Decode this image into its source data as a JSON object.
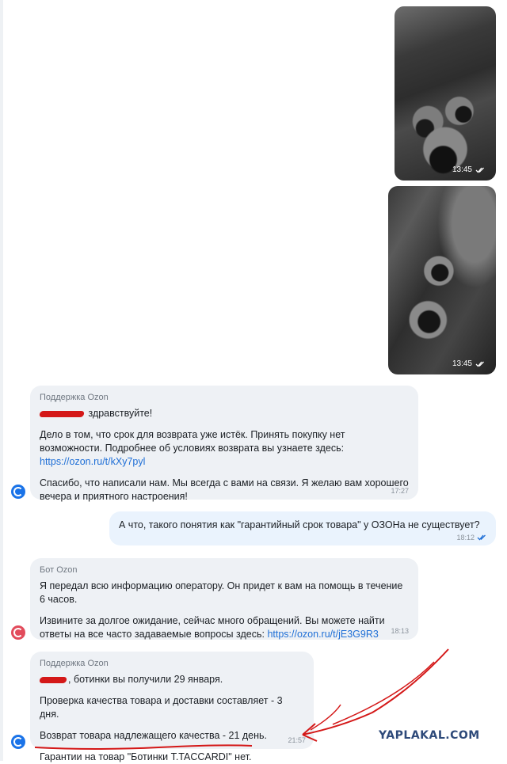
{
  "photos": [
    {
      "time": "13:45"
    },
    {
      "time": "13:45"
    }
  ],
  "messages": {
    "support1": {
      "sender": "Поддержка Ozon",
      "greeting": "здравствуйте!",
      "p1_text": "Дело в том, что срок для возврата уже истёк. Принять покупку нет возможности. Подробнее об условиях возврата вы узнаете здесь:",
      "p1_link": "https://ozon.ru/t/kXy7pyl",
      "p2": "Спасибо, что написали нам. Мы всегда с вами на связи. Я желаю вам хорошего вечера и приятного настроения!",
      "time": "17:27"
    },
    "user": {
      "text": "А что, такого понятия как \"гарантийный срок товара\" у ОЗОНа не существует?",
      "time": "18:12"
    },
    "bot": {
      "sender": "Бот Ozon",
      "p1": "Я передал всю информацию оператору. Он придет к вам на помощь в течение 6 часов.",
      "p2_text": "Извините за долгое ожидание, сейчас много обращений. Вы можете найти ответы на все часто задаваемые вопросы здесь:",
      "p2_link": "https://ozon.ru/t/jE3G9R3",
      "time": "18:13"
    },
    "support2": {
      "sender": "Поддержка Ozon",
      "line1": ", ботинки вы получили 29 января.",
      "line2": "Проверка качества товара и доставки составляет - 3 дня.",
      "line3": "Возврат товара надлежащего качества - 21 день.",
      "line4": "Гарантии на товар \"Ботинки T.TACCARDI\" нет.",
      "time": "21:57"
    }
  },
  "watermark": "YAPLAKAL.COM",
  "colors": {
    "accent": "#1f6fd6",
    "annotation": "#d41818",
    "bubble": "#eef1f5"
  }
}
